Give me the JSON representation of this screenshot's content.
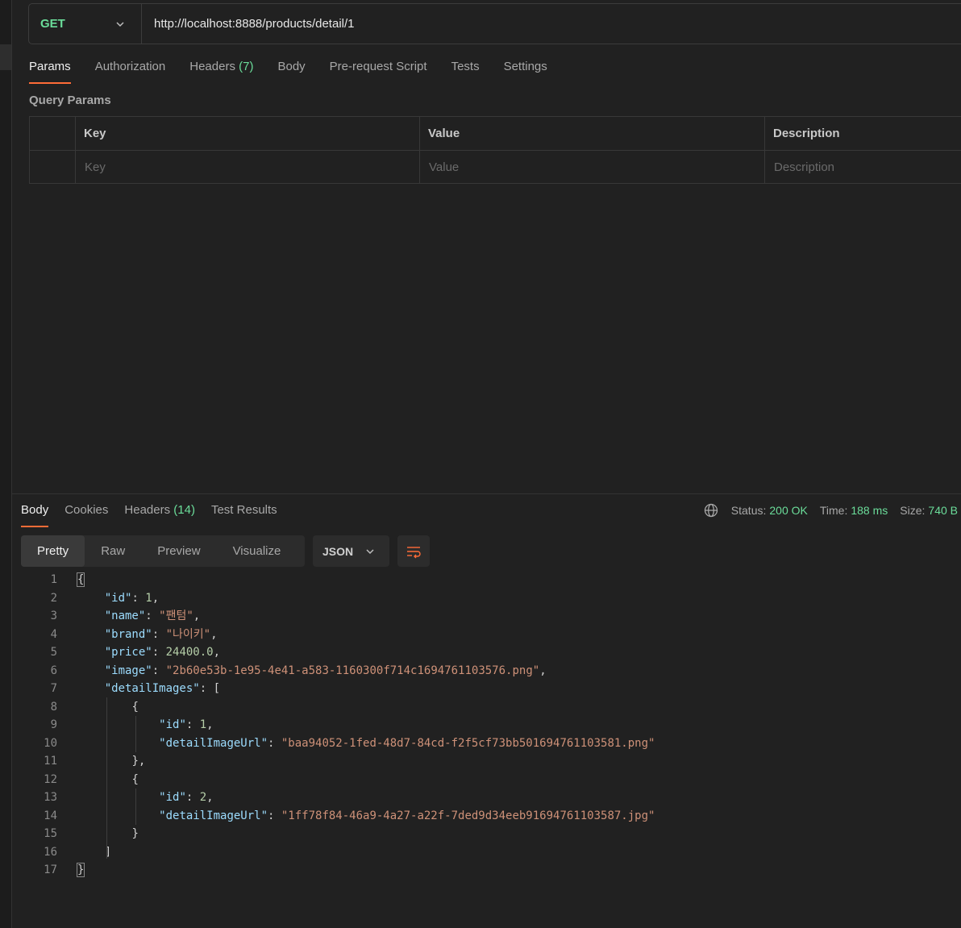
{
  "request": {
    "method": "GET",
    "url": "http://localhost:8888/products/detail/1"
  },
  "request_tabs": {
    "params": "Params",
    "authorization": "Authorization",
    "headers": "Headers",
    "headers_count": "(7)",
    "body": "Body",
    "prerequest": "Pre-request Script",
    "tests": "Tests",
    "settings": "Settings"
  },
  "query_params": {
    "title": "Query Params",
    "columns": {
      "key": "Key",
      "value": "Value",
      "description": "Description"
    },
    "placeholders": {
      "key": "Key",
      "value": "Value",
      "description": "Description"
    }
  },
  "response_tabs": {
    "body": "Body",
    "cookies": "Cookies",
    "headers": "Headers",
    "headers_count": "(14)",
    "test_results": "Test Results"
  },
  "response_status": {
    "status_label": "Status:",
    "status_value": "200 OK",
    "time_label": "Time:",
    "time_value": "188 ms",
    "size_label": "Size:",
    "size_value": "740 B"
  },
  "view_modes": {
    "pretty": "Pretty",
    "raw": "Raw",
    "preview": "Preview",
    "visualize": "Visualize"
  },
  "format_select": "JSON",
  "body_lines": {
    "n1": "1",
    "n2": "2",
    "n3": "3",
    "n4": "4",
    "n5": "5",
    "n6": "6",
    "n7": "7",
    "n8": "8",
    "n9": "9",
    "n10": "10",
    "n11": "11",
    "n12": "12",
    "n13": "13",
    "n14": "14",
    "n15": "15",
    "n16": "16",
    "n17": "17",
    "k_id": "\"id\"",
    "v_id": "1",
    "k_name": "\"name\"",
    "v_name": "\"팬텀\"",
    "k_brand": "\"brand\"",
    "v_brand": "\"나이키\"",
    "k_price": "\"price\"",
    "v_price": "24400.0",
    "k_image": "\"image\"",
    "v_image": "\"2b60e53b-1e95-4e41-a583-1160300f714c1694761103576.png\"",
    "k_detail_images": "\"detailImages\"",
    "k_d1_id": "\"id\"",
    "v_d1_id": "1",
    "k_d1_url": "\"detailImageUrl\"",
    "v_d1_url": "\"baa94052-1fed-48d7-84cd-f2f5cf73bb501694761103581.png\"",
    "k_d2_id": "\"id\"",
    "v_d2_id": "2",
    "k_d2_url": "\"detailImageUrl\"",
    "v_d2_url": "\"1ff78f84-46a9-4a27-a22f-7ded9d34eeb91694761103587.jpg\""
  },
  "colors": {
    "accent": "#ff6c37",
    "success": "#6bdd9a",
    "json_key": "#9cdcfe",
    "json_string": "#ce9178",
    "json_number": "#b5cea8"
  }
}
